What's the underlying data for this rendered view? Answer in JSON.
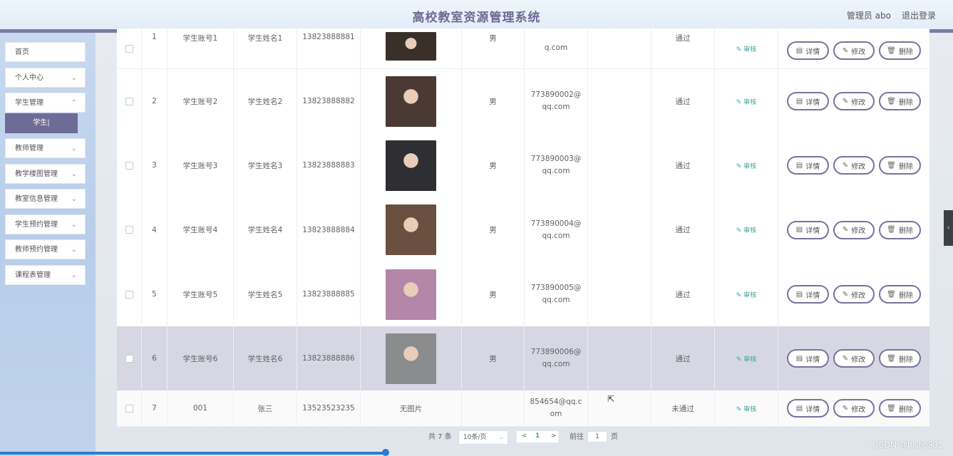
{
  "header": {
    "title": "高校教室资源管理系统",
    "admin_label": "管理员 abo",
    "logout_label": "退出登录"
  },
  "sidebar": {
    "items": [
      {
        "label": "首页"
      },
      {
        "label": "个人中心"
      },
      {
        "label": "学生管理"
      },
      {
        "label": "教师管理"
      },
      {
        "label": "教学楼图管理"
      },
      {
        "label": "教室信息管理"
      },
      {
        "label": "学生预约管理"
      },
      {
        "label": "教师预约管理"
      },
      {
        "label": "课程表管理"
      }
    ],
    "active_sub": "学生|"
  },
  "table": {
    "rows": [
      {
        "no": "1",
        "account": "学生账号1",
        "name": "学生姓名1",
        "phone": "13823888881",
        "gender": "男",
        "email": "q.com",
        "status": "通过",
        "photo": "photo",
        "bg": "#3a302a"
      },
      {
        "no": "2",
        "account": "学生账号2",
        "name": "学生姓名2",
        "phone": "13823888882",
        "gender": "男",
        "email": "773890002@qq.com",
        "status": "通过",
        "photo": "photo",
        "bg": "#4a3a33"
      },
      {
        "no": "3",
        "account": "学生账号3",
        "name": "学生姓名3",
        "phone": "13823888883",
        "gender": "男",
        "email": "773890003@qq.com",
        "status": "通过",
        "photo": "photo",
        "bg": "#2f2f33"
      },
      {
        "no": "4",
        "account": "学生账号4",
        "name": "学生姓名4",
        "phone": "13823888884",
        "gender": "男",
        "email": "773890004@qq.com",
        "status": "通过",
        "photo": "photo",
        "bg": "#6a5040"
      },
      {
        "no": "5",
        "account": "学生账号5",
        "name": "学生姓名5",
        "phone": "13823888885",
        "gender": "男",
        "email": "773890005@qq.com",
        "status": "通过",
        "photo": "photo",
        "bg": "#b487a8"
      },
      {
        "no": "6",
        "account": "学生账号6",
        "name": "学生姓名6",
        "phone": "13823888886",
        "gender": "男",
        "email": "773890006@qq.com",
        "status": "通过",
        "photo": "photo",
        "bg": "#8b8c8e"
      },
      {
        "no": "7",
        "account": "001",
        "name": "张三",
        "phone": "13523523235",
        "gender": "",
        "email": "854654@qq.com",
        "status": "未通过",
        "photo": "无图片",
        "bg": ""
      }
    ],
    "audit_label": "审核",
    "detail_label": "详情",
    "edit_label": "修改",
    "delete_label": "删除"
  },
  "pagination": {
    "total": "共 7 条",
    "page_size": "10条/页",
    "current_page": "1",
    "goto_label": "前往",
    "goto_value": "1",
    "page_unit": "页",
    "prev": "<",
    "next": ">"
  },
  "watermark": "CSDN @bishe981",
  "colors": {
    "accent": "#76749c",
    "header_border": "#7b7aa3",
    "audit": "#3aa79a"
  }
}
